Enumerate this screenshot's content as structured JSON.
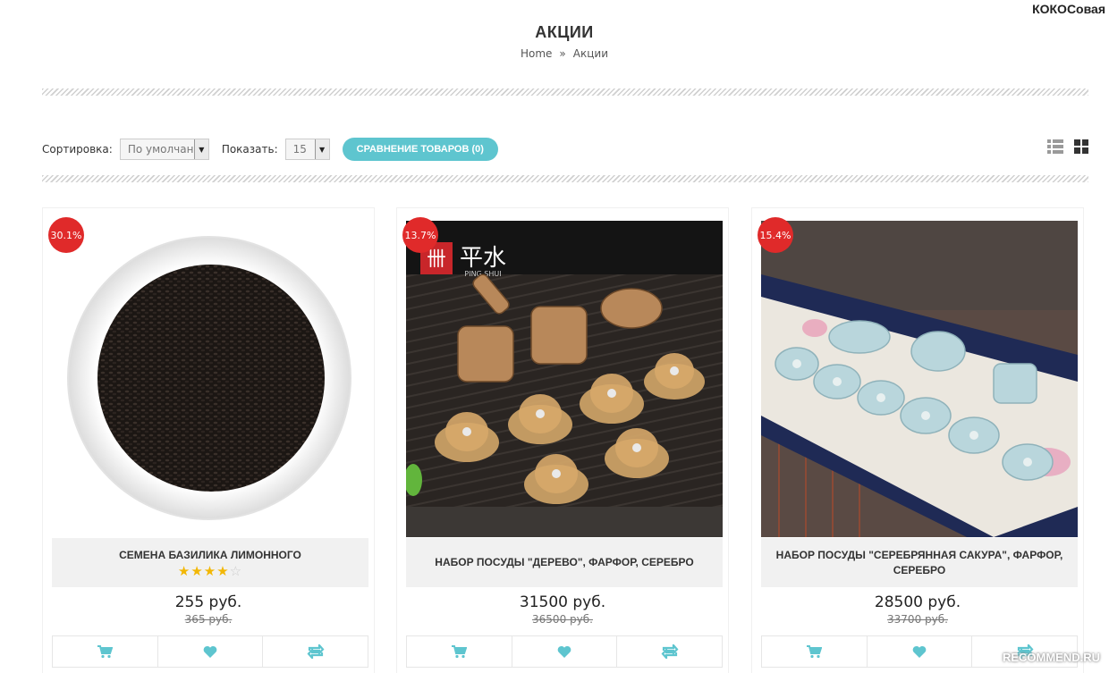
{
  "header": {
    "username": "КОКОСовая"
  },
  "page": {
    "title": "АКЦИИ"
  },
  "breadcrumb": {
    "home": "Home",
    "separator": "»",
    "current": "Акции"
  },
  "toolbar": {
    "sort_label": "Сортировка:",
    "sort_value": "По умолчанию",
    "show_label": "Показать:",
    "show_value": "15",
    "compare_label": "СРАВНЕНИЕ ТОВАРОВ (0)",
    "views": [
      "list-view-icon",
      "grid-view-icon"
    ]
  },
  "products": [
    {
      "discount": "30.1%",
      "name": "СЕМЕНА БАЗИЛИКА ЛИМОННОГО",
      "rating": 4,
      "rating_max": 5,
      "price": "255 руб.",
      "old_price": "365 руб."
    },
    {
      "discount": "13.7%",
      "name": "НАБОР ПОСУДЫ \"ДЕРЕВО\", ФАРФОР, СЕРЕБРО",
      "price": "31500 руб.",
      "old_price": "36500 руб.",
      "image_logo_text": "平水",
      "image_logo_sub": "PING SHUI"
    },
    {
      "discount": "15.4%",
      "name": "НАБОР ПОСУДЫ \"СЕРЕБРЯННАЯ САКУРА\", ФАРФОР, СЕРЕБРО",
      "price": "28500 руб.",
      "old_price": "33700 руб."
    }
  ],
  "colors": {
    "accent": "#5ec5cf",
    "badge": "#e02a2a",
    "star": "#f2b705"
  },
  "watermark": "RECOMMEND.RU"
}
